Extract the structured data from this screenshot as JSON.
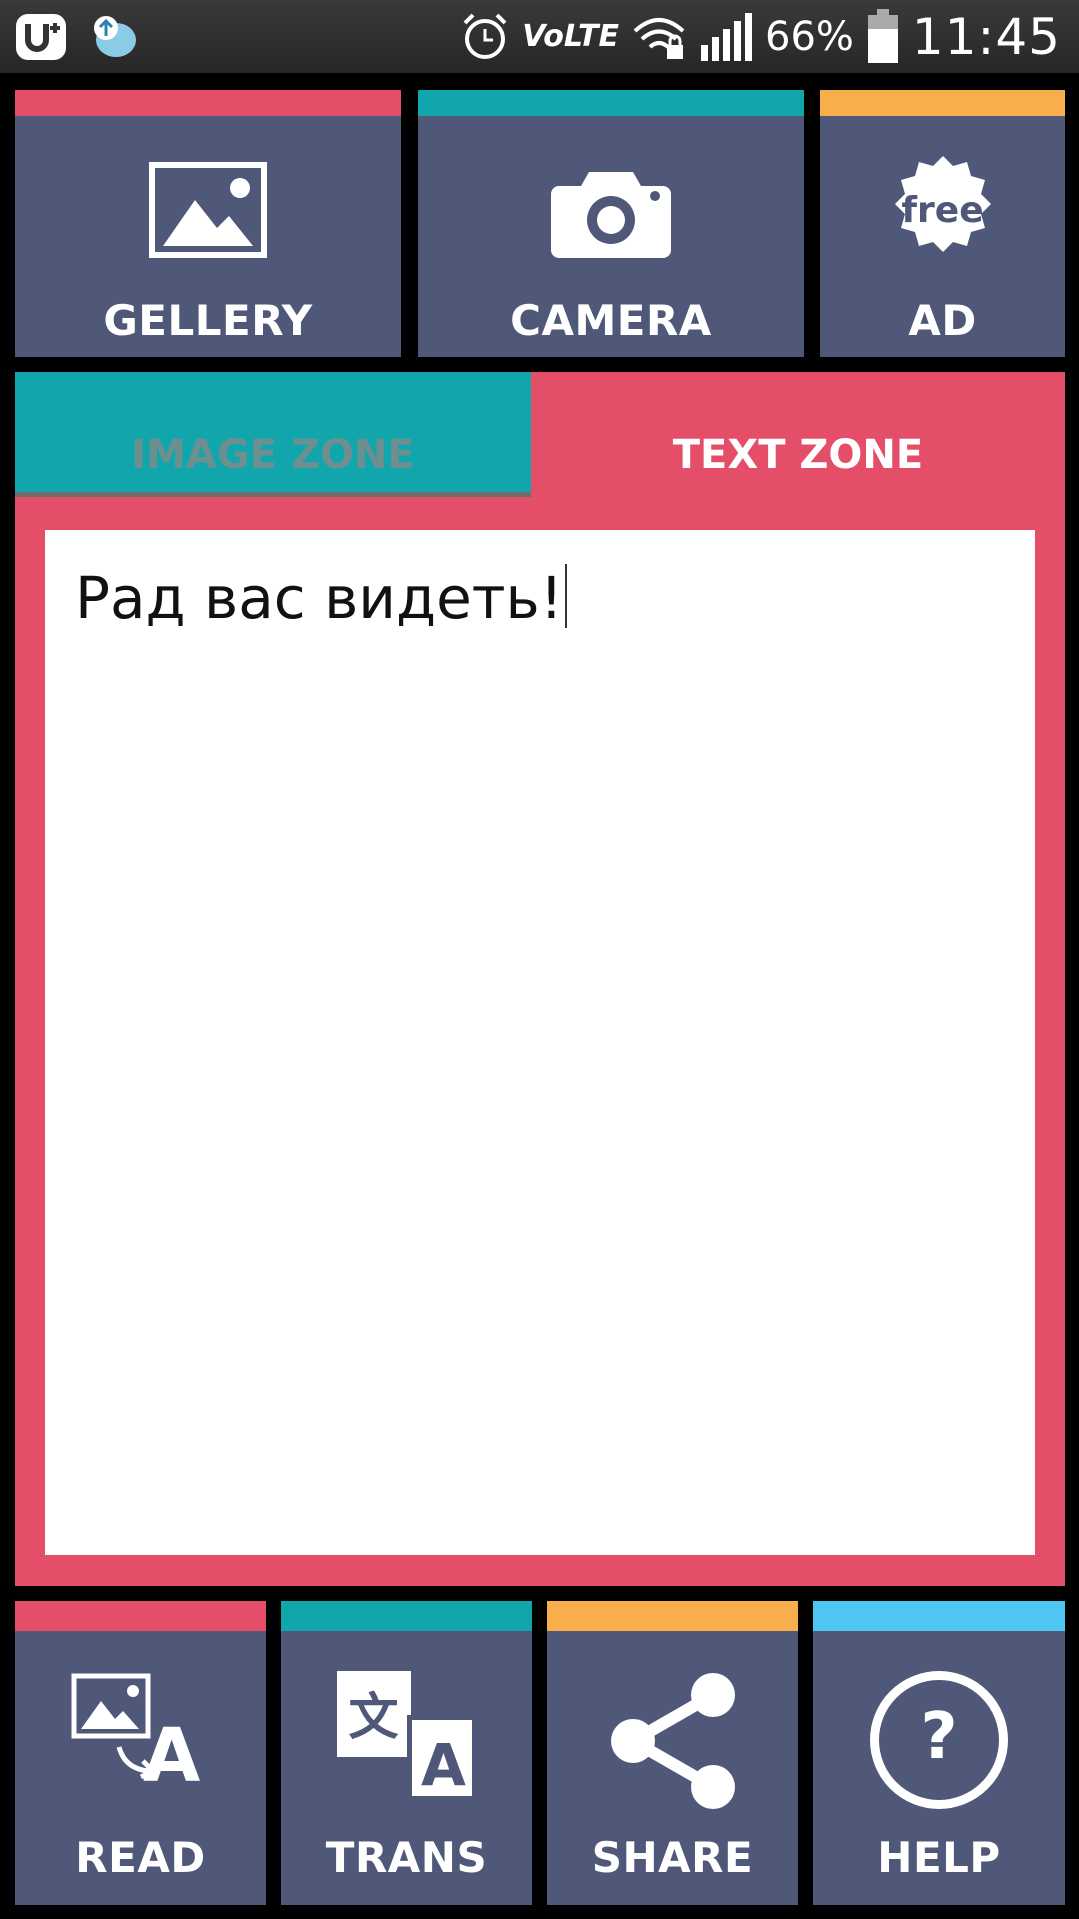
{
  "status_bar": {
    "volte": "VoLTE",
    "battery_percent": "66%",
    "time": "11:45",
    "icons": [
      "app-u-icon",
      "upload-bubble-icon",
      "alarm-icon",
      "volte-icon",
      "wifi-lock-icon",
      "signal-icon",
      "battery-icon"
    ]
  },
  "top_actions": {
    "gallery_label": "GELLERY",
    "camera_label": "CAMERA",
    "ad_label": "AD",
    "ad_badge": "free"
  },
  "tabs": {
    "image_zone": "IMAGE ZONE",
    "text_zone": "TEXT ZONE",
    "active": "TEXT ZONE"
  },
  "text_zone": {
    "value": "Рад вас видеть!"
  },
  "bottom_actions": {
    "read_label": "READ",
    "trans_label": "TRANS",
    "trans_icon_glyph": "文",
    "trans_icon_letter": "A",
    "read_icon_letter": "A",
    "share_label": "SHARE",
    "help_label": "HELP",
    "help_glyph": "?"
  },
  "colors": {
    "tile_bg": "#4f5878",
    "red": "#e44e68",
    "teal": "#11a6ac",
    "orange": "#f8ae4b",
    "blue": "#4fc5f2"
  }
}
